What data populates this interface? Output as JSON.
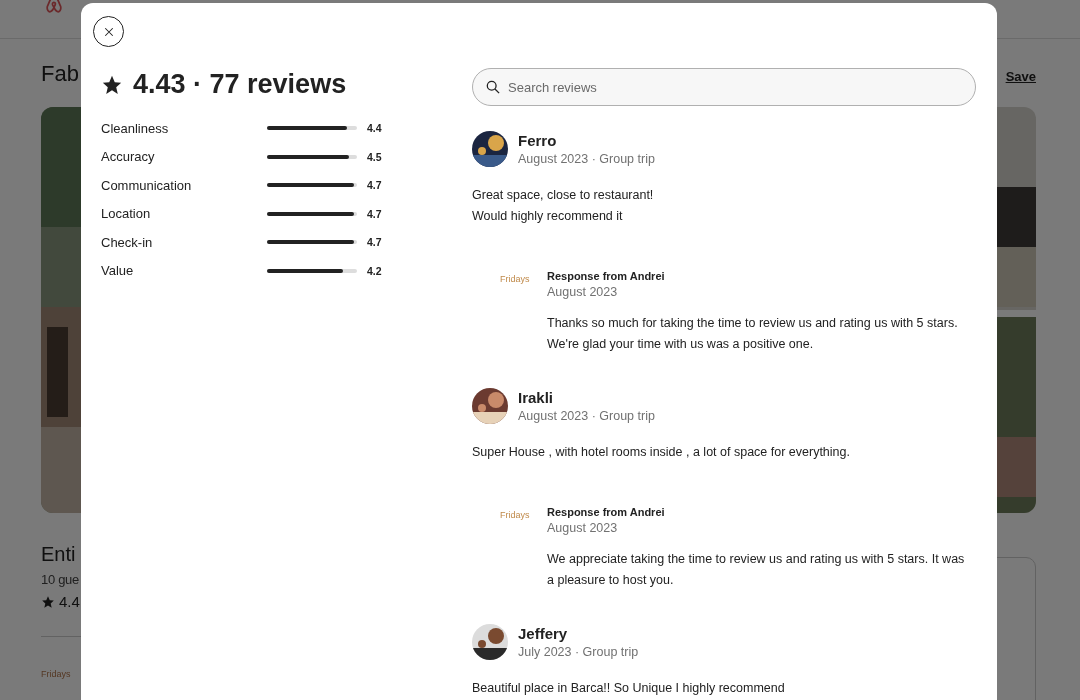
{
  "background_page": {
    "title": "Fab",
    "save_link": "Save",
    "subtitle": "Enti",
    "details": "10 gue",
    "rating": "4.4",
    "host_logo": "Fridays"
  },
  "dialog": {
    "rating_summary": "4.43 · 77 reviews",
    "search": {
      "placeholder": "Search reviews"
    },
    "categories": [
      {
        "name": "Cleanliness",
        "score": "4.4",
        "level": 0.89
      },
      {
        "name": "Accuracy",
        "score": "4.5",
        "level": 0.91
      },
      {
        "name": "Communication",
        "score": "4.7",
        "level": 0.97
      },
      {
        "name": "Location",
        "score": "4.7",
        "level": 0.97
      },
      {
        "name": "Check-in",
        "score": "4.7",
        "level": 0.97
      },
      {
        "name": "Value",
        "score": "4.2",
        "level": 0.84
      }
    ],
    "reviews": [
      {
        "name": "Ferro",
        "meta": "August 2023 · Group trip",
        "lines": [
          "Great space, close to restaurant!",
          "Would highly recommend it"
        ],
        "response": {
          "logo": "Fridays",
          "heading": "Response from Andrei",
          "date": "August 2023",
          "lines": [
            "Thanks so much for taking the time to review us and rating us with 5 stars.",
            "We're glad your time with us was a positive one."
          ]
        }
      },
      {
        "name": "Irakli",
        "meta": "August 2023 · Group trip",
        "lines": [
          "Super House , with hotel rooms inside , a lot of space for everything."
        ],
        "response": {
          "logo": "Fridays",
          "heading": "Response from Andrei",
          "date": "August 2023",
          "lines": [
            "We appreciate taking the time to review us and rating us with 5 stars. It was",
            "a pleasure to host you."
          ]
        }
      },
      {
        "name": "Jeffery",
        "meta": "July 2023 · Group trip",
        "lines": [
          "Beautiful place in Barca!! So Unique I highly recommend"
        ]
      }
    ]
  }
}
